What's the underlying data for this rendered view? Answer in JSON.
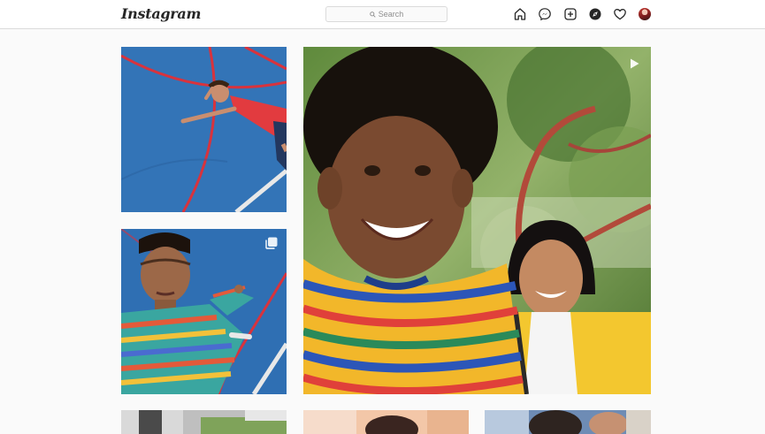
{
  "app": {
    "logo": "Instagram"
  },
  "search": {
    "placeholder": "Search"
  },
  "nav": {
    "icons": [
      "home-icon",
      "messenger-icon",
      "new-post-icon",
      "explore-icon",
      "activity-heart-icon",
      "profile-avatar"
    ]
  },
  "grid": {
    "posts": [
      {
        "id": "post-1",
        "type": "photo",
        "subject": "person lying on blue sports court"
      },
      {
        "id": "post-2",
        "type": "video",
        "subject": "two friends smiling selfie under tree"
      },
      {
        "id": "post-3",
        "type": "carousel",
        "subject": "young man in striped sweater on court"
      },
      {
        "id": "post-4",
        "type": "photo",
        "subject": "partial row"
      },
      {
        "id": "post-5",
        "type": "photo",
        "subject": "partial row"
      },
      {
        "id": "post-6",
        "type": "photo",
        "subject": "partial row"
      }
    ]
  },
  "colors": {
    "court_blue": "#2f6fb3",
    "court_red": "#d8333d",
    "topbar_border": "#dbdbdb",
    "background": "#fafafa"
  }
}
